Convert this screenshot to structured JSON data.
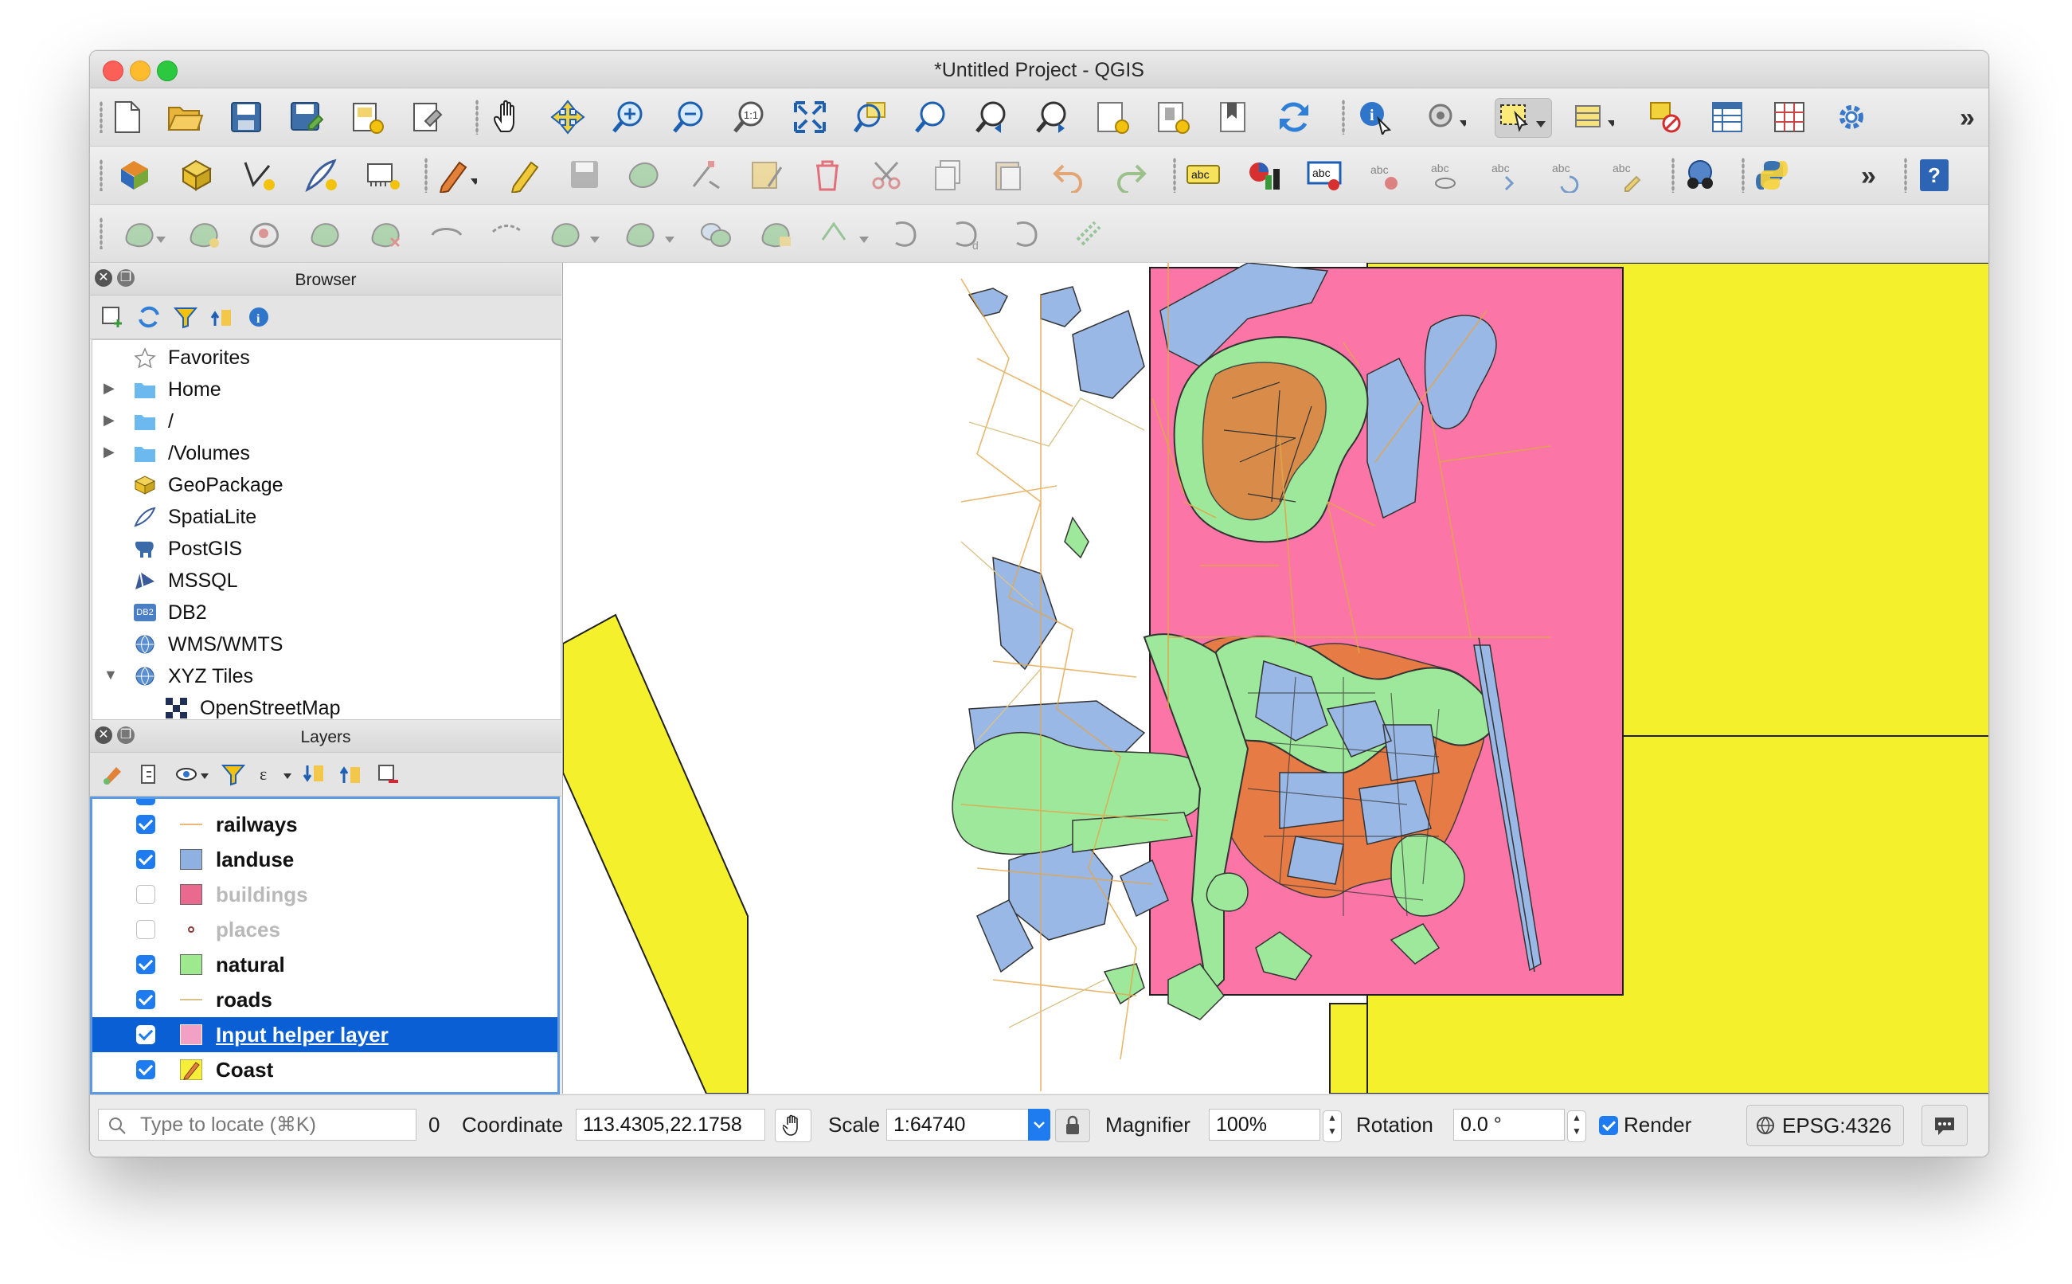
{
  "window": {
    "title": "*Untitled Project - QGIS"
  },
  "toolbar1": {
    "tools": [
      "new-project",
      "open-project",
      "save-project",
      "save-as",
      "new-print-layout",
      "layout-manager",
      "pan",
      "pan-to-selection",
      "zoom-in",
      "zoom-out",
      "zoom-native",
      "zoom-full",
      "zoom-to-selection",
      "zoom-to-layer",
      "zoom-last",
      "zoom-next",
      "new-map-view",
      "new-3d-view",
      "new-bookmark",
      "refresh",
      "identify",
      "measure",
      "select-features",
      "attribute-table-select",
      "deselect",
      "open-attribute-table",
      "statistics",
      "options"
    ],
    "more": "»"
  },
  "toolbar2": {
    "tools": [
      "data-source-manager",
      "new-geopackage-layer",
      "new-shapefile-layer",
      "new-spatialite-layer",
      "new-virtual-layer",
      "current-edits",
      "toggle-editing",
      "save-edits",
      "add-feature",
      "vertex-tool",
      "modify-attributes",
      "delete-selected",
      "cut-features",
      "copy-features",
      "paste-features",
      "undo",
      "redo",
      "labels",
      "diagram",
      "highlight-pinned-labels",
      "pin-labels",
      "show-hide-labels",
      "move-label",
      "rotate-label",
      "change-label",
      "metasearch",
      "python-console"
    ],
    "more": "»",
    "help": "?"
  },
  "toolbar3": {
    "tools": [
      "add-ring",
      "add-part",
      "fill-ring",
      "delete-ring",
      "delete-part",
      "reshape",
      "offset-curve",
      "split-features",
      "split-parts",
      "merge-features",
      "merge-attributes",
      "rotate-point-symbols",
      "simplify",
      "reverse-line",
      "offset-point",
      "digitize-shape"
    ]
  },
  "browser": {
    "title": "Browser",
    "items": [
      {
        "label": "Favorites",
        "arrow": "",
        "icon": "star"
      },
      {
        "label": "Home",
        "arrow": "▶",
        "icon": "folder"
      },
      {
        "label": "/",
        "arrow": "▶",
        "icon": "folder"
      },
      {
        "label": "/Volumes",
        "arrow": "▶",
        "icon": "folder"
      },
      {
        "label": "GeoPackage",
        "arrow": "",
        "icon": "geopackage"
      },
      {
        "label": "SpatiaLite",
        "arrow": "",
        "icon": "feather"
      },
      {
        "label": "PostGIS",
        "arrow": "",
        "icon": "elephant"
      },
      {
        "label": "MSSQL",
        "arrow": "",
        "icon": "mssql"
      },
      {
        "label": "DB2",
        "arrow": "",
        "icon": "db2"
      },
      {
        "label": "WMS/WMTS",
        "arrow": "",
        "icon": "globe"
      },
      {
        "label": "XYZ Tiles",
        "arrow": "▼",
        "icon": "globe"
      },
      {
        "label": "OpenStreetMap",
        "arrow": "",
        "icon": "tiles"
      }
    ],
    "db2_text": "DB2"
  },
  "layers": {
    "title": "Layers",
    "items": [
      {
        "label": "railways",
        "checked": true,
        "symbol": "line",
        "color": "#e8b97a"
      },
      {
        "label": "landuse",
        "checked": true,
        "symbol": "fill",
        "color": "#8fb0e0"
      },
      {
        "label": "buildings",
        "checked": false,
        "symbol": "fill",
        "color": "#ea6a8f"
      },
      {
        "label": "places",
        "checked": false,
        "symbol": "point",
        "color": "#8a3b3b"
      },
      {
        "label": "natural",
        "checked": true,
        "symbol": "fill",
        "color": "#9ee88e"
      },
      {
        "label": "roads",
        "checked": true,
        "symbol": "line",
        "color": "#d9c38a"
      },
      {
        "label": "Input helper layer",
        "checked": true,
        "symbol": "fill",
        "color": "#f2a0c4",
        "selected": true
      },
      {
        "label": "Coast",
        "checked": true,
        "symbol": "pencil",
        "color": "#f6ef3a"
      }
    ]
  },
  "map": {
    "colors": {
      "coast": "#f4f12c",
      "helper": "#fb76a6",
      "landuse": "#9ab8e6",
      "natural": "#9de89a",
      "roads": "#e2a54a",
      "outline": "#1f1f1f"
    }
  },
  "statusbar": {
    "locate_placeholder": "Type to locate (⌘K)",
    "messages_count": "0",
    "coordinate_label": "Coordinate",
    "coordinate_value": "113.4305,22.1758",
    "scale_label": "Scale",
    "scale_value": "1:64740",
    "magnifier_label": "Magnifier",
    "magnifier_value": "100%",
    "rotation_label": "Rotation",
    "rotation_value": "0.0 °",
    "render_label": "Render",
    "render_checked": true,
    "crs": "EPSG:4326"
  }
}
